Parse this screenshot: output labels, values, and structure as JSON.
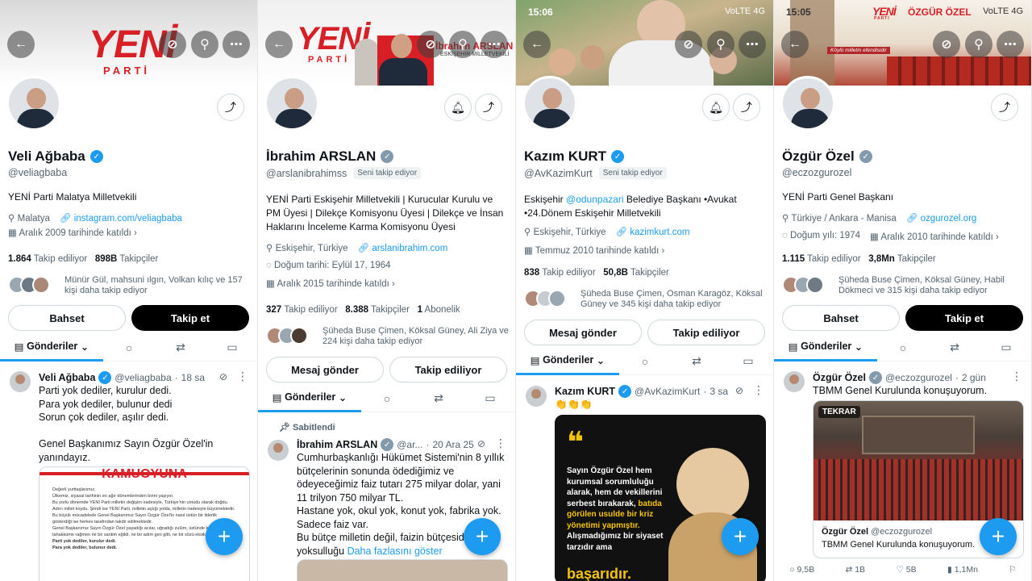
{
  "panels": [
    {
      "status": {
        "time": "",
        "icons": ""
      },
      "banner": {
        "logo_word": "YENİ",
        "logo_sub": "PARTİ"
      },
      "header_icons": {
        "back": "arrow-left-icon",
        "grok": "grok-icon",
        "search": "search-icon",
        "more": "more-icon"
      },
      "profile": {
        "name": "Veli Ağbaba",
        "handle": "@veliagbaba",
        "follows_you": "",
        "bio": "YENİ Parti Malatya Milletvekili",
        "location": "Malatya",
        "link": "instagram.com/veliagbaba",
        "birth": "",
        "joined": "Aralık 2009 tarihinde katıldı",
        "following": "1.864",
        "following_label": "Takip ediliyor",
        "followers": "898B",
        "followers_label": "Takipçiler",
        "subscribers": "",
        "subscribers_label": "",
        "followed_by": "Münür Gül, mahsuni ılgın, Volkan kılıç ve 157 kişi daha takip ediyor"
      },
      "buttons": {
        "left": "Bahset",
        "right": "Takip et"
      },
      "tabs": {
        "posts": "Gönderiler"
      },
      "post": {
        "pinned": "",
        "name": "Veli Ağbaba",
        "handle": "@veliagbaba",
        "time": "18 sa",
        "text": "Parti yok dediler, kurulur dedi.\nPara yok dediler, bulunur dedi\nSorun çok dediler, aşılır dedi.\n\nGenel Başkanımız Sayın Özgür Özel'in yanındayız.",
        "more_link": "",
        "media_title": "KAMUOYUNA",
        "media_lines": [
          "Değerli yurttaşlarımız,",
          "Ülkemiz, siyasal tarihinin en ağır dönemlerinden birini yaşıyor.",
          "Bu zorlu dönemde YENİ Parti milletin değişim iradesiyle, Türkiye'nin umudu olarak doğdu. Adını millet koydu. Şimdi ise YENİ Parti, milletin açtığı yolda, milletin iradesiyle büyümektedir.",
          "Bu büyük mücadelede Genel Başkanımız Sayın Özgür Özel'in nasıl üstün bir liderlik gösterdiği ise herkes tarafından takdir edilmektedir.",
          "Genel Başkanımız Sayın Özgür Özel yaşadığı acılar, uğradığı zulüm, üstünde kurulan tahakküme rağmen ne bir santim eğildi, ne bir adım geri gitti, ne bir sözü eksik söyledi.",
          "Parti yok dediler, kurulur dedi.",
          "Para yok dediler, bulunur dedi."
        ]
      }
    },
    {
      "status": {
        "time": "",
        "icons": ""
      },
      "banner": {
        "logo_word": "YENİ",
        "logo_sub": "PARTİ",
        "banner_name": "İbrahim ARSLAN",
        "banner_role": "ESKİŞEHİR MİLLETVEKİLİ"
      },
      "header_icons": {
        "back": "arrow-left-icon",
        "grok": "grok-icon",
        "search": "search-icon",
        "more": "more-icon"
      },
      "profile": {
        "name": "İbrahim ARSLAN",
        "handle": "@arslanibrahimss",
        "follows_you": "Seni takip ediyor",
        "bio": "YENİ Parti Eskişehir Milletvekili | Kurucular Kurulu ve PM Üyesi | Dilekçe Komisyonu Üyesi | Dilekçe ve İnsan Haklarını İnceleme Karma Komisyonu Üyesi",
        "location": "Eskişehir, Türkiye",
        "link": "arslanibrahim.com",
        "birth": "Doğum tarihi: Eylül 17, 1964",
        "joined": "Aralık 2015 tarihinde katıldı",
        "following": "327",
        "following_label": "Takip ediliyor",
        "followers": "8.388",
        "followers_label": "Takipçiler",
        "subscribers": "1",
        "subscribers_label": "Abonelik",
        "followed_by": "Şüheda Buse Çimen, Köksal Güney, Ali Ziya ve 224 kişi daha takip ediyor"
      },
      "buttons": {
        "left": "Mesaj gönder",
        "right": "Takip ediliyor"
      },
      "tabs": {
        "posts": "Gönderiler"
      },
      "post": {
        "pinned": "Sabitlendi",
        "name": "İbrahim ARSLAN",
        "handle": "@ar...",
        "time": "20 Ara 25",
        "text": "Cumhurbaşkanlığı Hükümet Sistemi'nin 8 yıllık bütçelerinin sonunda ödediğimiz ve ödeyeceğimiz faiz tutarı 275 milyar dolar, yani 11 trilyon 750 milyar TL.\nHastane yok, okul yok, konut yok, fabrika yok.\nSadece faiz var.\nBu bütçe milletin değil, faizin bütçesidir, yoksulluğu",
        "more_link": "Daha fazlasını göster"
      }
    },
    {
      "status": {
        "time": "15:06",
        "icons": "VoLTE 4G"
      },
      "header_icons": {
        "back": "arrow-left-icon",
        "grok": "grok-icon",
        "search": "search-icon",
        "more": "more-icon"
      },
      "profile": {
        "name": "Kazım KURT",
        "handle": "@AvKazimKurt",
        "follows_you": "Seni takip ediyor",
        "bio_prefix": "Eskişehir ",
        "bio_mention": "@odunpazari",
        "bio": "Belediye Başkanı •Avukat •24.Dönem Eskişehir Milletvekili",
        "location": "Eskişehir, Türkiye",
        "link": "kazimkurt.com",
        "birth": "",
        "joined": "Temmuz 2010 tarihinde katıldı",
        "following": "838",
        "following_label": "Takip ediliyor",
        "followers": "50,8B",
        "followers_label": "Takipçiler",
        "subscribers": "",
        "subscribers_label": "",
        "followed_by": "Şüheda Buse Çimen, Osman Karagöz, Köksal Güney ve 345 kişi daha takip ediyor"
      },
      "buttons": {
        "left": "Mesaj gönder",
        "right": "Takip ediliyor"
      },
      "tabs": {
        "posts": "Gönderiler"
      },
      "post": {
        "pinned": "",
        "name": "Kazım KURT",
        "handle": "@AvKazimKurt",
        "time": "3 sa",
        "text": "👏👏👏",
        "more_link": "",
        "media_quote": "Sayın Özgür Özel hem kurumsal sorumluluğu alarak, hem de vekillerini serbest bırakarak,",
        "media_highlight": "batıda görülen usulde bir kriz yönetimi yapmıştır.",
        "media_rest": "Alışmadığımız bir siyaset tarzıdır ama",
        "media_big": "başarıdır."
      }
    },
    {
      "status": {
        "time": "15:05",
        "icons": "VoLTE 4G"
      },
      "banner": {
        "logo_word": "YENİ",
        "logo_sub": "PARTİ",
        "banner_name": "ÖZGÜR ÖZEL",
        "banner_slogan": "Köylü milletin efendisidir"
      },
      "header_icons": {
        "back": "arrow-left-icon",
        "grok": "grok-icon",
        "search": "search-icon",
        "more": "more-icon"
      },
      "profile": {
        "name": "Özgür Özel",
        "handle": "@eczozgurozel",
        "follows_you": "",
        "bio": "YENİ Parti Genel Başkanı",
        "location": "Türkiye / Ankara - Manisa",
        "link": "ozgurozel.org",
        "birth": "Doğum yılı: 1974",
        "joined": "Aralık 2010 tarihinde katıldı",
        "following": "1.115",
        "following_label": "Takip ediliyor",
        "followers": "3,8Mn",
        "followers_label": "Takipçiler",
        "subscribers": "",
        "subscribers_label": "",
        "followed_by": "Şüheda Buse Çimen, Köksal Güney, Habil Dökmeci ve 315 kişi daha takip ediyor"
      },
      "buttons": {
        "left": "Bahset",
        "right": "Takip et"
      },
      "tabs": {
        "posts": "Gönderiler"
      },
      "post": {
        "pinned": "",
        "name": "Özgür Özel",
        "handle": "@eczozgurozel",
        "time": "2 gün",
        "text": "TBMM Genel Kurulunda konuşuyorum.",
        "more_link": "",
        "media_badge": "TEKRAR",
        "card_name": "Özgür Özel",
        "card_handle": "@eczozgurozel",
        "card_text": "TBMM Genel Kurulunda konuşuyorum.",
        "stats": {
          "replies": "9,5B",
          "reposts": "1B",
          "likes": "5B",
          "views": "1,1Mn"
        }
      }
    }
  ],
  "colors": {
    "accent": "#1d9bf0",
    "brand_red": "#d81f26",
    "text": "#0f1419",
    "muted": "#536471"
  }
}
